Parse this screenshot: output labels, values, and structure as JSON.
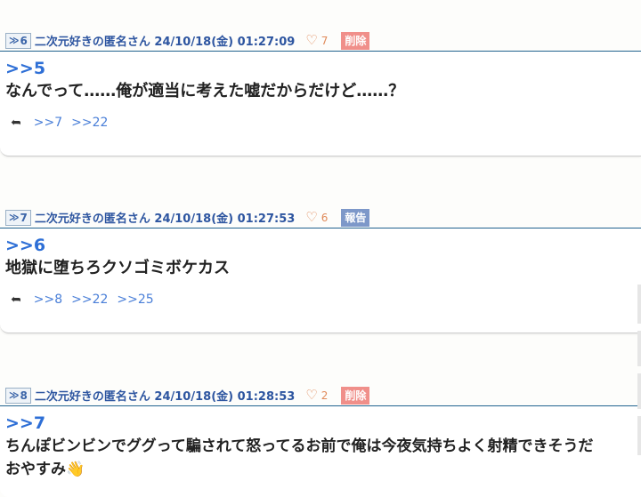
{
  "posts": [
    {
      "number": "6",
      "author": "二次元好きの匿名さん",
      "date": "24/10/18(金)",
      "time": "01:27:09",
      "likes": "7",
      "tag": "削除",
      "tag_type": "del",
      "anchor": ">>5",
      "text": "なんでって……俺が適当に考えた嘘だからだけど……？",
      "replies": [
        ">>7",
        ">>22"
      ]
    },
    {
      "number": "7",
      "author": "二次元好きの匿名さん",
      "date": "24/10/18(金)",
      "time": "01:27:53",
      "likes": "6",
      "tag": "報告",
      "tag_type": "rep",
      "anchor": ">>6",
      "text": "地獄に堕ちろクソゴミボケカス",
      "replies": [
        ">>8",
        ">>22",
        ">>25"
      ]
    },
    {
      "number": "8",
      "author": "二次元好きの匿名さん",
      "date": "24/10/18(金)",
      "time": "01:28:53",
      "likes": "2",
      "tag": "削除",
      "tag_type": "del",
      "anchor": ">>7",
      "text": "ちんぽビンビンでググって騙されて怒ってるお前で俺は今夜気持ちよく射精できそうだ",
      "text2": "おやすみ👋",
      "replies": []
    }
  ],
  "icons": {
    "number_arrow": "double-chevron-right-icon",
    "like": "heart-icon",
    "reply": "reply-arrow-icon"
  },
  "colors": {
    "accent": "#2e6fd6",
    "meta": "#2d55a0",
    "delete_tag": "#f08f8a",
    "report_tag": "#7d98c9",
    "like": "#e08a5a"
  }
}
